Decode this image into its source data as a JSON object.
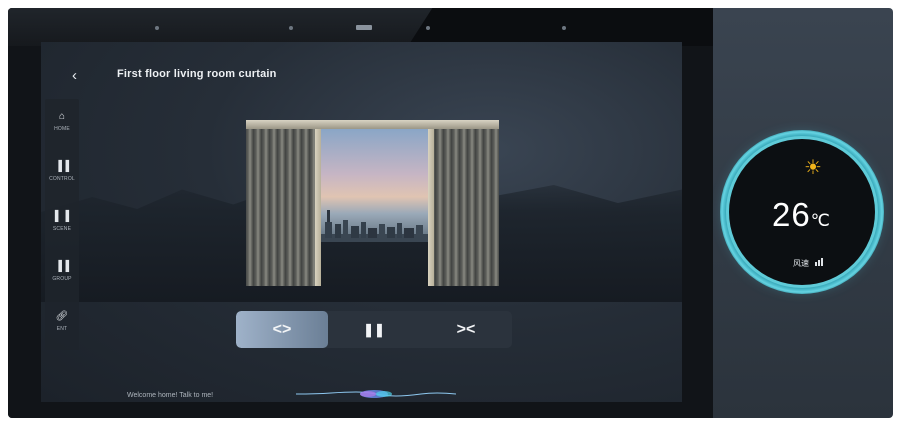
{
  "page": {
    "title": "First floor living room curtain",
    "back_icon": "chevron-left-icon"
  },
  "sidebar": {
    "items": [
      {
        "label": "HOME",
        "icon": "home-icon"
      },
      {
        "label": "CONTROL",
        "icon": "control-icon"
      },
      {
        "label": "SCENE",
        "icon": "scene-icon"
      },
      {
        "label": "GROUP",
        "icon": "group-icon"
      },
      {
        "label": "ENT",
        "icon": "entertainment-icon"
      }
    ]
  },
  "controls": {
    "open_symbol": "<>",
    "pause_symbol": "❚❚",
    "close_symbol": "><",
    "active": "open"
  },
  "voice": {
    "welcome": "Welcome home! Talk to me!"
  },
  "thermostat": {
    "mode_icon": "sun-icon",
    "temperature": "26",
    "unit": "℃",
    "fan_label": "风速",
    "accent": "#5fcbd8"
  }
}
